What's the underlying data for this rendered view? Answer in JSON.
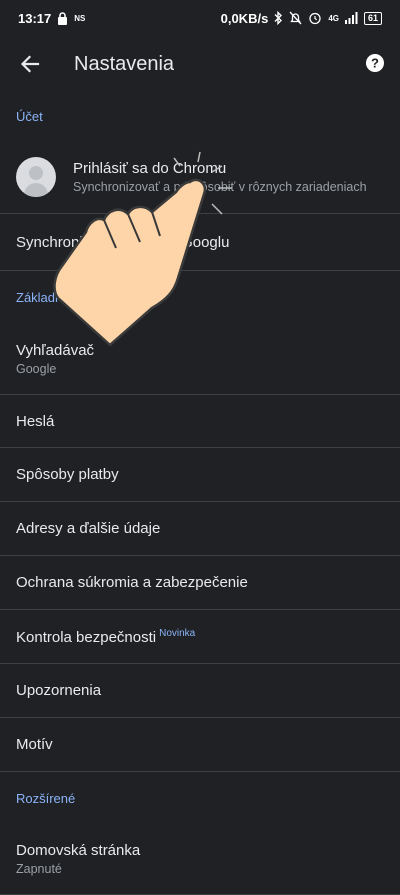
{
  "status": {
    "time": "13:17",
    "ns": "NS",
    "network_speed": "0,0KB/s",
    "signal": "4G",
    "battery": "61"
  },
  "header": {
    "title": "Nastavenia"
  },
  "sections": {
    "account_header": "Účet",
    "basics_header": "Základné",
    "advanced_header": "Rozšírené"
  },
  "account": {
    "signin_title": "Prihlásiť sa do Chromu",
    "signin_sub": "Synchronizovať a prispôsobiť v rôznych zariadeniach",
    "sync_label": "Synchronizácia a služby Googlu"
  },
  "items": {
    "search_engine": "Vyhľadávač",
    "search_engine_value": "Google",
    "passwords": "Heslá",
    "payment_methods": "Spôsoby platby",
    "addresses": "Adresy a ďalšie údaje",
    "privacy": "Ochrana súkromia a zabezpečenie",
    "safety_check": "Kontrola bezpečnosti",
    "safety_check_badge": "Novinka",
    "notifications": "Upozornenia",
    "theme": "Motív",
    "homepage": "Domovská stránka",
    "homepage_value": "Zapnuté"
  },
  "icons": {
    "back": "back-arrow-icon",
    "help": "help-icon",
    "avatar": "account-avatar-icon",
    "hand": "tap-hand-icon"
  },
  "colors": {
    "background": "#202124",
    "accent": "#8ab4f8",
    "divider": "#3c4043",
    "text": "#e8eaed",
    "secondary_text": "#9aa0a6"
  }
}
